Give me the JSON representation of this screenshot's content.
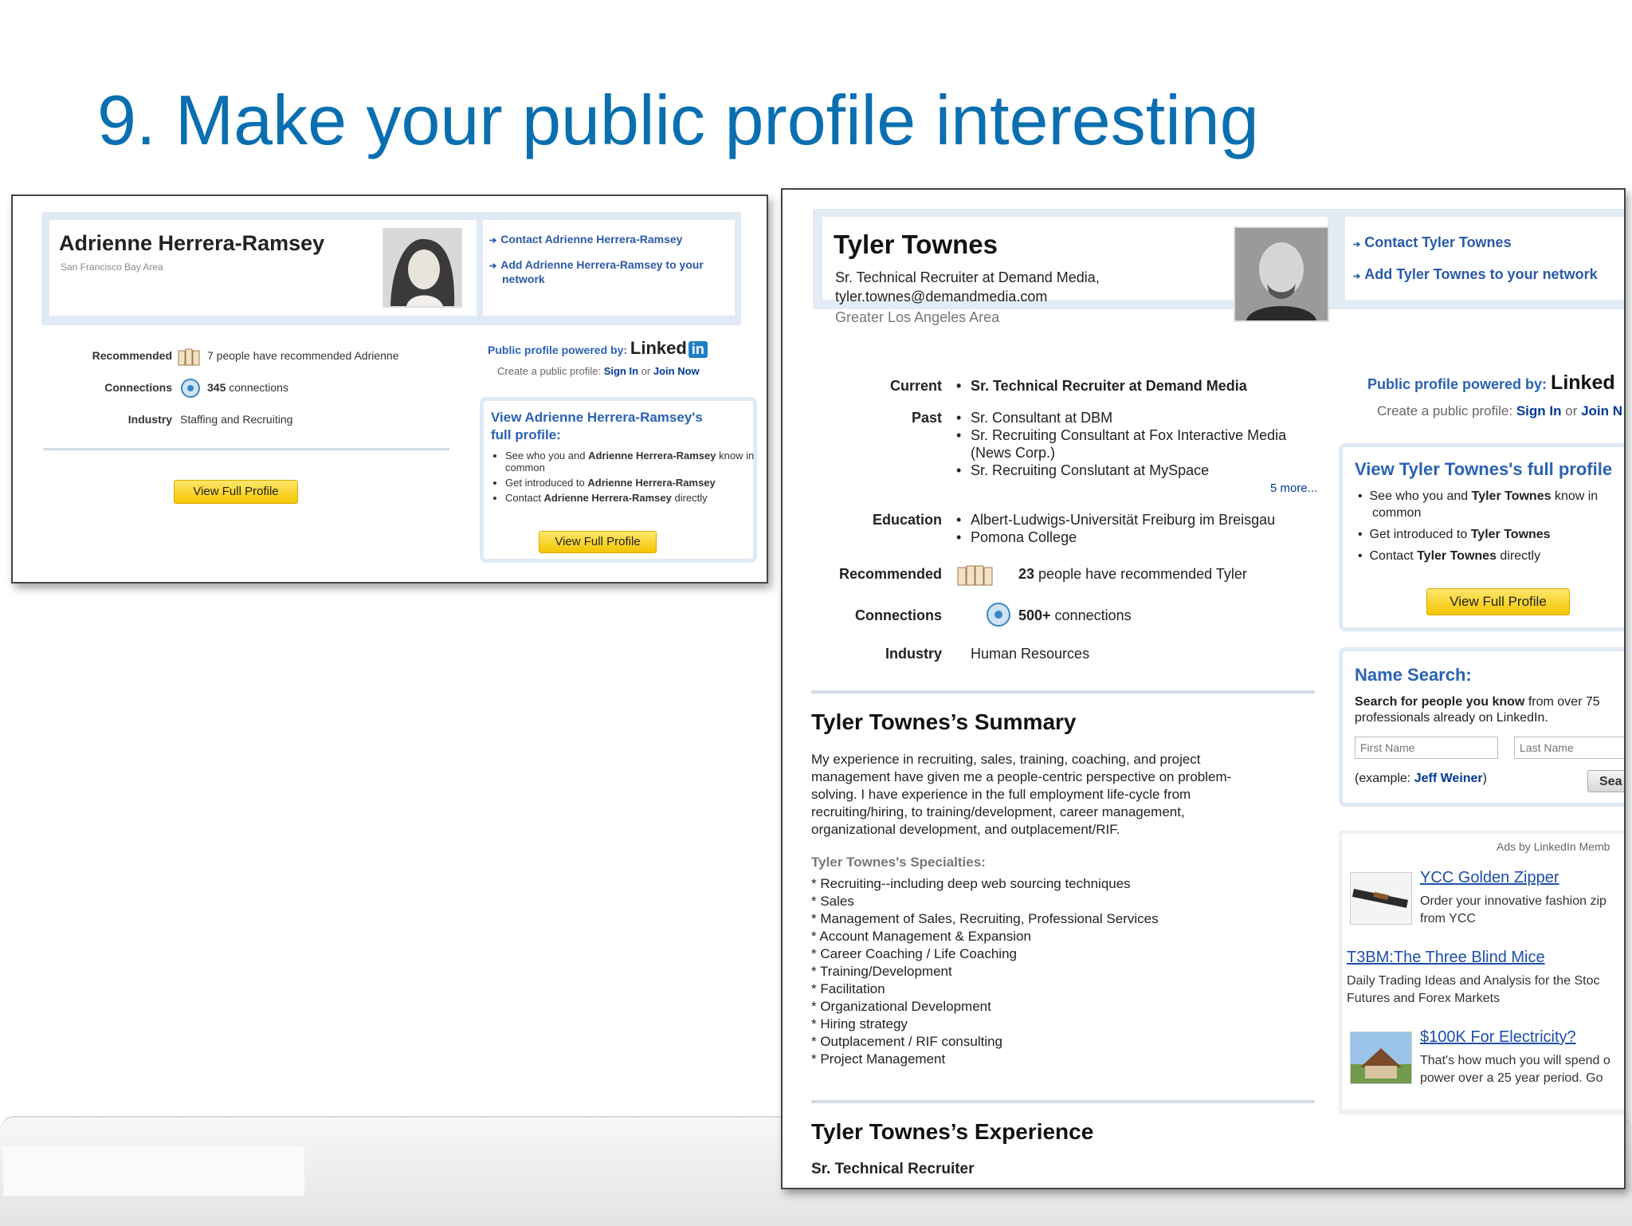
{
  "slide": {
    "title": "9. Make your public profile interesting"
  },
  "small_profile": {
    "name": "Adrienne Herrera-Ramsey",
    "location": "San Francisco Bay Area",
    "contact_link": "Contact Adrienne Herrera-Ramsey",
    "add_link_line1": "Add Adrienne Herrera-Ramsey to your",
    "add_link_line2": "network",
    "recommended_label": "Recommended",
    "recommended_value": "7 people have recommended Adrienne",
    "connections_label": "Connections",
    "connections_count": "345",
    "connections_text": " connections",
    "industry_label": "Industry",
    "industry_value": "Staffing and Recruiting",
    "powered_by": "Public profile powered by:",
    "linkedin_text": "Linked",
    "linkedin_badge": "in",
    "create_text": "Create a public profile:",
    "sign_in": "Sign In",
    "or_text": "or",
    "join_now": "Join Now",
    "view_full_title_line1": "View Adrienne Herrera-Ramsey's",
    "view_full_title_line2": "full profile:",
    "bullet1a": "See who you and",
    "bullet1b": "Adrienne Herrera-Ramsey",
    "bullet1c": "know in common",
    "bullet2a": "Get introduced to",
    "bullet2b": "Adrienne Herrera-Ramsey",
    "bullet3a": "Contact",
    "bullet3b": "Adrienne Herrera-Ramsey",
    "bullet3c": "directly",
    "view_full_button": "View Full Profile"
  },
  "large_profile": {
    "name": "Tyler Townes",
    "headline_line1": "Sr. Technical Recruiter at Demand Media,",
    "headline_line2": "tyler.townes@demandmedia.com",
    "location": "Greater Los Angeles Area",
    "contact_link": "Contact Tyler Townes",
    "add_link": "Add Tyler Townes to your network",
    "current_label": "Current",
    "current_value": "Sr. Technical Recruiter at Demand Media",
    "past_label": "Past",
    "past_items": [
      "Sr. Consultant at DBM",
      "Sr. Recruiting Consultant at Fox Interactive Media",
      "(News Corp.)",
      "Sr. Recruiting Conslutant at MySpace"
    ],
    "more_link": "5 more...",
    "education_label": "Education",
    "education_items": [
      "Albert-Ludwigs-Universität Freiburg im Breisgau",
      "Pomona College"
    ],
    "recommended_label": "Recommended",
    "recommended_count": "23",
    "recommended_text": " people have recommended Tyler",
    "connections_label": "Connections",
    "connections_count": "500+",
    "connections_text": " connections",
    "industry_label": "Industry",
    "industry_value": "Human Resources",
    "summary_title": "Tyler Townes’s Summary",
    "summary_lines": [
      "My experience in recruiting, sales, training, coaching, and project",
      "management have given me a people-centric perspective on problem-",
      "solving. I have experience in the full employment life-cycle from",
      "recruiting/hiring, to training/development, career management,",
      "organizational development, and outplacement/RIF."
    ],
    "specialties_title": "Tyler Townes's Specialties:",
    "specialties": [
      "* Recruiting--including deep web sourcing techniques",
      "* Sales",
      "* Management of Sales, Recruiting, Professional Services",
      "* Account Management & Expansion",
      "* Career Coaching / Life Coaching",
      "* Training/Development",
      "* Facilitation",
      "* Organizational Development",
      "* Hiring strategy",
      "* Outplacement / RIF consulting",
      "* Project Management"
    ],
    "experience_title": "Tyler Townes’s Experience",
    "experience_role": "Sr. Technical Recruiter",
    "powered_by": "Public profile powered by:",
    "linkedin_text": "Linked",
    "create_text": "Create a public profile:",
    "sign_in": "Sign In",
    "or_text": "or",
    "join_now": "Join N",
    "view_full_title": "View Tyler Townes's full profile",
    "bullet1a": "See who you and",
    "bullet1b": "Tyler Townes",
    "bullet1c": "know in",
    "bullet1d": "common",
    "bullet2a": "Get introduced to",
    "bullet2b": "Tyler Townes",
    "bullet3a": "Contact",
    "bullet3b": "Tyler Townes",
    "bullet3c": "directly",
    "view_full_button": "View Full Profile",
    "name_search_title": "Name Search:",
    "name_search_desc_bold": "Search for people you know",
    "name_search_desc_rest": " from over 75",
    "name_search_desc_line2": "professionals already on LinkedIn.",
    "first_name_placeholder": "First Name",
    "last_name_placeholder": "Last Name",
    "example_prefix": "(example: ",
    "example_name": "Jeff Weiner",
    "example_suffix": ")",
    "search_button": "Sea",
    "ads_label": "Ads by LinkedIn Memb",
    "ads": [
      {
        "title": "YCC Golden Zipper",
        "line1": "Order your innovative fashion zip",
        "line2": "from YCC"
      },
      {
        "title": "T3BM:The Three Blind Mice",
        "line1": "Daily Trading Ideas and Analysis for the Stoc",
        "line2": "Futures and Forex Markets"
      },
      {
        "title": "$100K For Electricity?",
        "line1": "That's how much you will spend o",
        "line2": "power over a 25 year period. Go"
      }
    ]
  }
}
